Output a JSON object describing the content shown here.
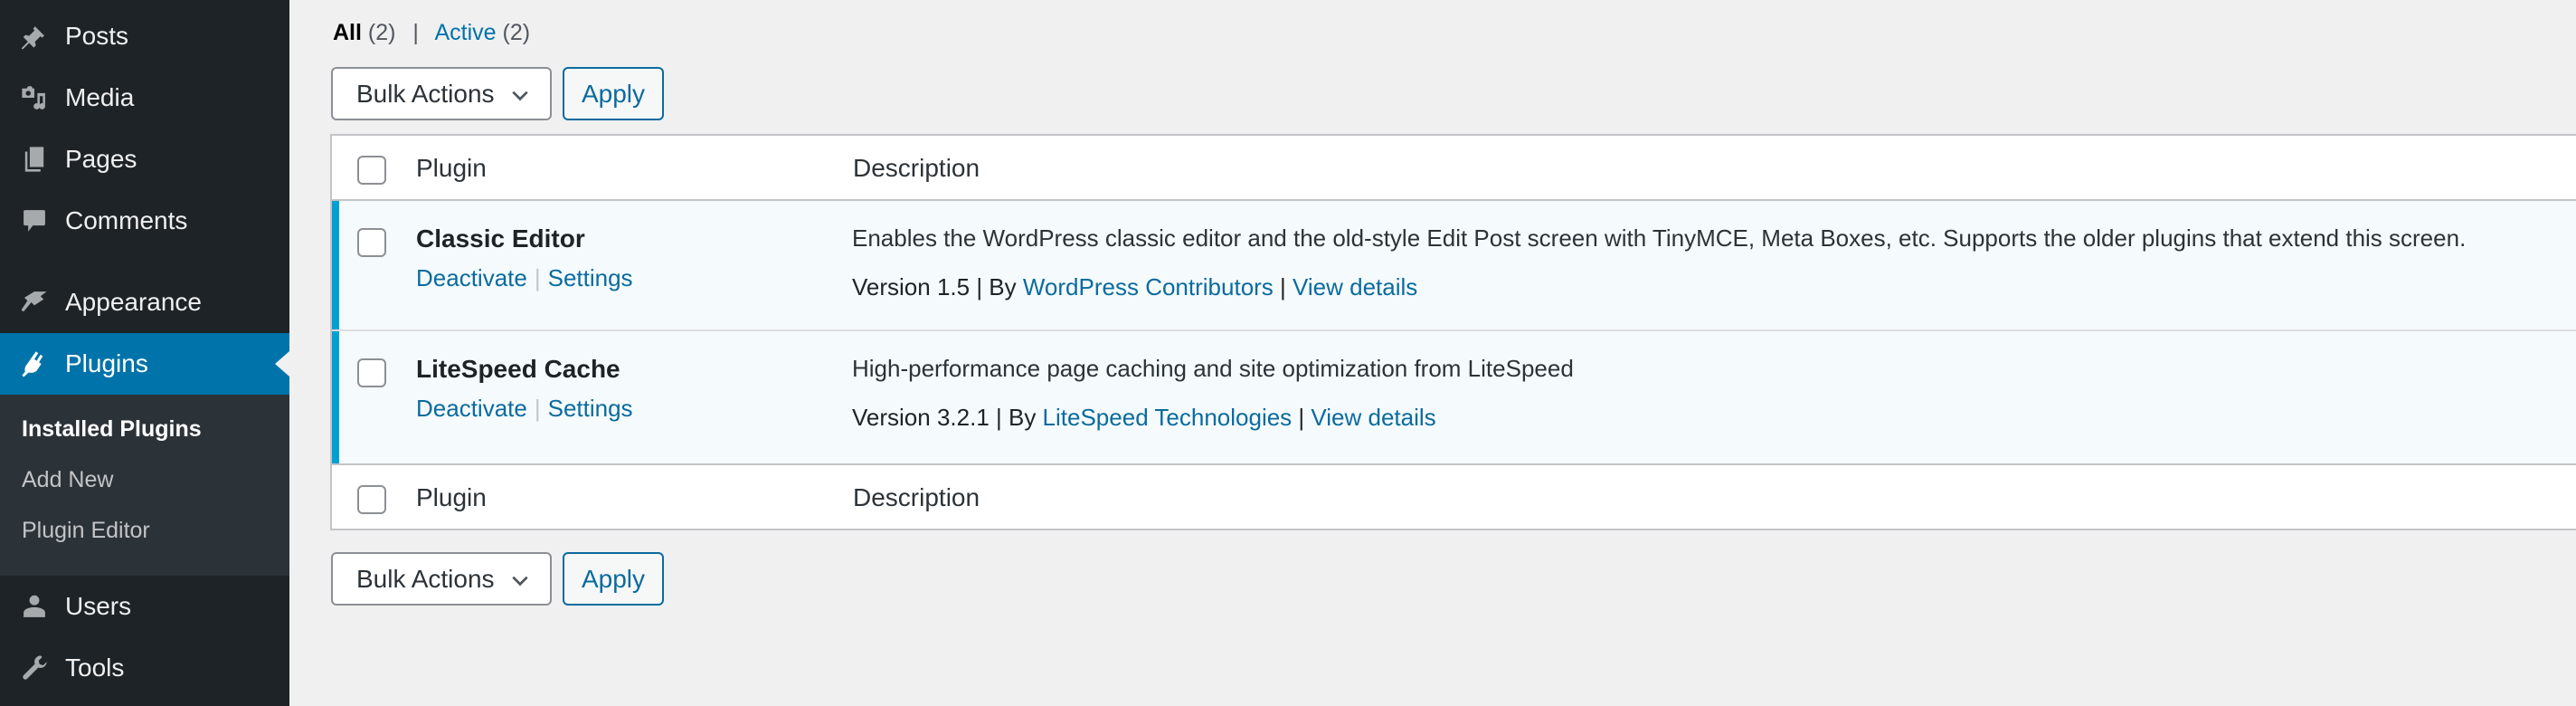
{
  "sidebar": {
    "items": [
      {
        "label": "Posts",
        "icon": "pin-icon"
      },
      {
        "label": "Media",
        "icon": "media-icon"
      },
      {
        "label": "Pages",
        "icon": "pages-icon"
      },
      {
        "label": "Comments",
        "icon": "comment-icon"
      },
      {
        "label": "Appearance",
        "icon": "paintbrush-icon"
      },
      {
        "label": "Plugins",
        "icon": "plugin-icon",
        "active": true
      },
      {
        "label": "Users",
        "icon": "user-icon"
      },
      {
        "label": "Tools",
        "icon": "wrench-icon"
      }
    ],
    "submenu": [
      {
        "label": "Installed Plugins",
        "current": true
      },
      {
        "label": "Add New"
      },
      {
        "label": "Plugin Editor"
      }
    ]
  },
  "filters": {
    "all_label": "All",
    "all_count": "(2)",
    "separator": "|",
    "active_label": "Active",
    "active_count": "(2)"
  },
  "bulk_top": {
    "select_value": "Bulk Actions",
    "apply_label": "Apply"
  },
  "bulk_bottom": {
    "select_value": "Bulk Actions",
    "apply_label": "Apply"
  },
  "table": {
    "columns": [
      "Plugin",
      "Description"
    ],
    "rows": [
      {
        "name": "Classic Editor",
        "actions": [
          "Deactivate",
          "Settings"
        ],
        "description": "Enables the WordPress classic editor and the old-style Edit Post screen with TinyMCE, Meta Boxes, etc. Supports the older plugins that extend this screen.",
        "version_text": "Version 1.5 | By ",
        "author": "WordPress Contributors",
        "sep": " | ",
        "details": "View details"
      },
      {
        "name": "LiteSpeed Cache",
        "actions": [
          "Deactivate",
          "Settings"
        ],
        "description": "High-performance page caching and site optimization from LiteSpeed",
        "version_text": "Version 3.2.1 | By ",
        "author": "LiteSpeed Technologies",
        "sep": " | ",
        "details": "View details"
      }
    ]
  },
  "colors": {
    "sidebar_bg": "#1d2327",
    "active_menu": "#0073aa",
    "link": "#0a6b9e",
    "active_row_bar": "#00a0d2"
  }
}
